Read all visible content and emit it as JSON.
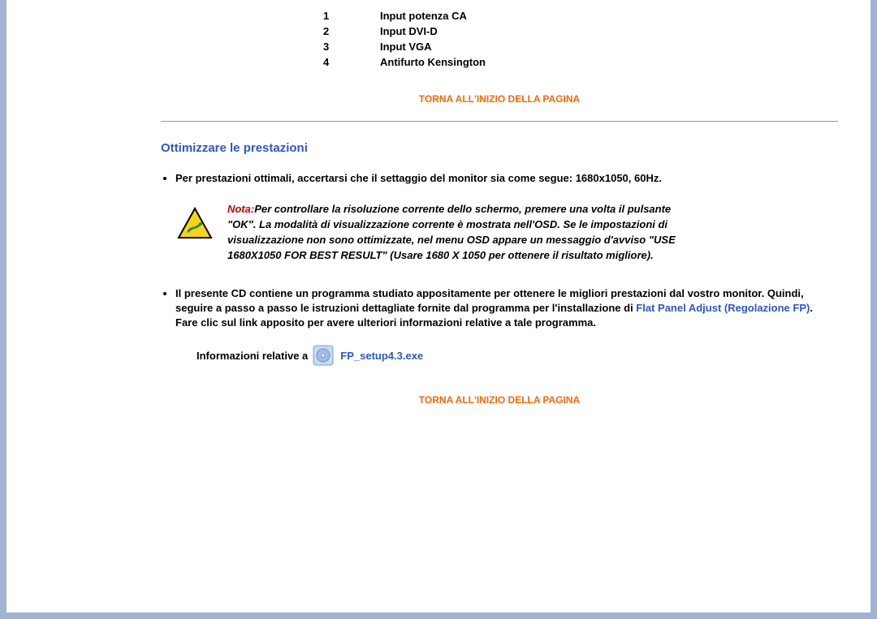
{
  "ports": [
    {
      "num": "1",
      "label": "Input potenza CA"
    },
    {
      "num": "2",
      "label": "Input DVI-D"
    },
    {
      "num": "3",
      "label": "Input VGA"
    },
    {
      "num": "4",
      "label": "Antifurto Kensington"
    }
  ],
  "back_to_top": "TORNA ALL'INIZIO DELLA PAGINA",
  "section": {
    "title": "Ottimizzare le prestazioni",
    "bullet1": "Per prestazioni ottimali, accertarsi che il settaggio del monitor sia come segue: 1680x1050, 60Hz.",
    "note_label": "Nota:",
    "note_body": "Per controllare la risoluzione corrente dello schermo, premere una volta il pulsante \"OK\". La modalità di visualizzazione corrente è mostrata nell'OSD. Se le impostazioni di visualizzazione non sono ottimizzate, nel menu OSD appare un messaggio d'avviso \"USE 1680X1050 FOR BEST RESULT\" (Usare 1680 X 1050 per ottenere il risultato migliore).",
    "bullet2_pre": "Il presente CD contiene un programma studiato appositamente per ottenere le migliori prestazioni dal vostro monitor. Quindi, seguire a passo a passo le istruzioni dettagliate fornite dal programma per l'installazione di ",
    "bullet2_link": "Flat Panel Adjust (Regolazione FP)",
    "bullet2_post": ". Fare clic sul link apposito per avere ulteriori informazioni relative a tale programma.",
    "info_prefix": "Informazioni relative a",
    "file_name": "FP_setup4.3.exe"
  }
}
